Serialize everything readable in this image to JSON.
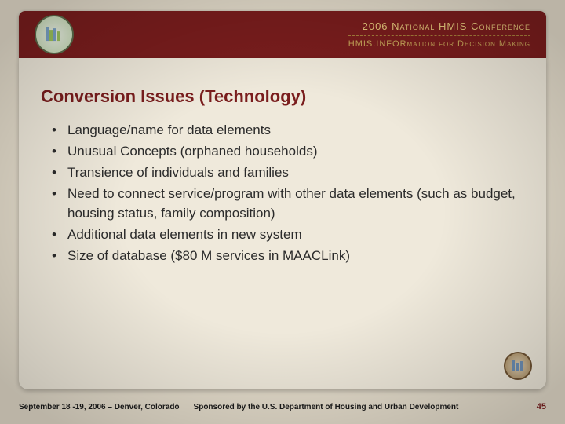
{
  "header": {
    "line1": "2006 National HMIS Conference",
    "line2": "HMIS.INFORmation for Decision Making"
  },
  "slide": {
    "title": "Conversion Issues (Technology)",
    "bullets": [
      "Language/name for data elements",
      "Unusual Concepts (orphaned households)",
      "Transience of individuals and families",
      "Need to connect service/program with other data elements (such as budget, housing status, family composition)",
      "Additional data elements in new system",
      "Size of database ($80 M services in MAACLink)"
    ]
  },
  "footer": {
    "left": "September 18 -19, 2006 – Denver, Colorado",
    "mid": "Sponsored by the U.S. Department of Housing and Urban Development",
    "page": "45"
  }
}
